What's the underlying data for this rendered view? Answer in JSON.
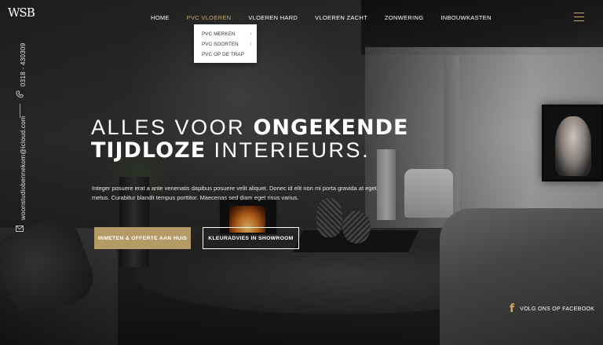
{
  "brand": {
    "logo_text": "WSB"
  },
  "contact": {
    "phone": "0318 - 430309",
    "email": "woonstudiobennekom@icloud.com"
  },
  "nav": {
    "items": [
      {
        "label": "HOME"
      },
      {
        "label": "PVC VLOEREN"
      },
      {
        "label": "VLOEREN HARD"
      },
      {
        "label": "VLOEREN ZACHT"
      },
      {
        "label": "ZONWERING"
      },
      {
        "label": "INBOUWKASTEN"
      }
    ],
    "active_index": 1,
    "dropdown": [
      {
        "label": "PVC MERKEN",
        "has_submenu": true
      },
      {
        "label": "PVC SOORTEN",
        "has_submenu": true
      },
      {
        "label": "PVC OP DE TRAP",
        "has_submenu": false
      }
    ]
  },
  "hero": {
    "headline_light_1": "ALLES VOOR",
    "headline_bold_1": "ONGEKENDE",
    "headline_bold_2": "TIJDLOZE",
    "headline_light_2": "INTERIEURS.",
    "intro": "Integer posuere erat a ante venenatis dapibus posuere velit aliquet. Donec id elit non mi porta gravida at eget metus. Curabitur blandit tempus porttitor. Maecenas sed diam eget risus varius.",
    "primary_button": "INMETEN & OFFERTE AAN HUIS",
    "secondary_button": "KLEURADVIES IN SHOWROOM"
  },
  "social": {
    "facebook_label": "VOLG ONS OP FACEBOOK"
  },
  "colors": {
    "accent": "#b49a64",
    "accent_light": "#c9a86a",
    "dropdown_bg": "#ffffff"
  },
  "icons": {
    "phone": "phone-icon",
    "mail": "mail-icon",
    "menu": "hamburger-menu-icon",
    "facebook": "facebook-icon"
  }
}
